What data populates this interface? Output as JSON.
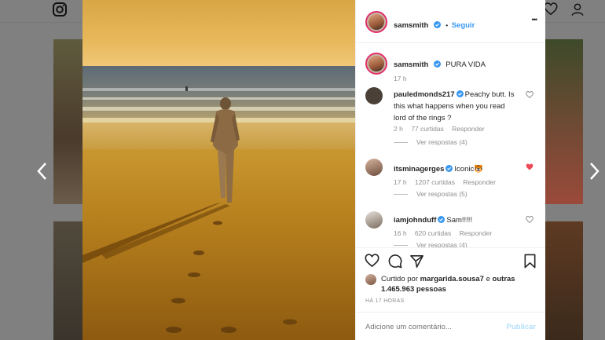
{
  "post": {
    "username": "samsmith",
    "follow_label": "Seguir",
    "caption_user": "samsmith",
    "caption": "PURA VIDA",
    "caption_time": "17 h",
    "likes_prefix": "Curtido por",
    "likes_user": "margarida.sousa7",
    "likes_rest": "e",
    "likes_count": "outras 1.465.963 pessoas",
    "posted_ago": "HÁ 17 HORAS",
    "comment_placeholder": "Adicione um comentário...",
    "publish_label": "Publicar",
    "more_label": "•••",
    "dot": "•"
  },
  "comments": [
    {
      "user": "pauledmonds217",
      "text": "Peachy butt. Is this what happens when you read lord of the rings ?",
      "time": "2 h",
      "likes": "77 curtidas",
      "reply": "Responder",
      "view_replies": "Ver respostas (4)",
      "liked": false
    },
    {
      "user": "itsminagerges",
      "text": "Iconic",
      "emoji": "🐯",
      "time": "17 h",
      "likes": "1207 curtidas",
      "reply": "Responder",
      "view_replies": "Ver respostas (5)",
      "liked": true
    },
    {
      "user": "iamjohnduff",
      "text": "Sam!!!!!",
      "time": "16 h",
      "likes": "620 curtidas",
      "reply": "Responder",
      "view_replies": "Ver respostas (4)",
      "liked": false
    }
  ],
  "colors": {
    "accent": "#3897f0",
    "liked_heart": "#ed4956",
    "publish_disabled": "#b2dffc"
  },
  "icons": [
    "instagram-icon",
    "compass-icon",
    "heart-icon",
    "profile-icon",
    "prev-arrow-icon",
    "next-arrow-icon",
    "verified-icon",
    "comment-icon",
    "share-icon",
    "bookmark-icon"
  ]
}
